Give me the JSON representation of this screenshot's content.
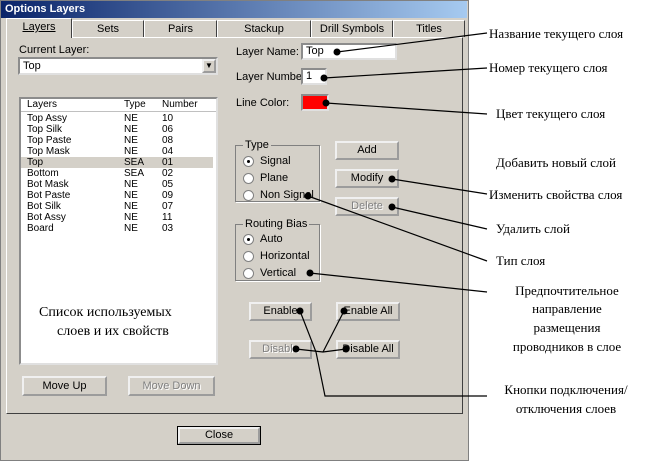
{
  "window": {
    "title": "Options Layers"
  },
  "tabs": [
    "Layers",
    "Sets",
    "Pairs",
    "Stackup",
    "Drill Symbols",
    "Titles"
  ],
  "current_layer": {
    "label": "Current Layer:",
    "value": "Top"
  },
  "list": {
    "headers": [
      "Layers",
      "Type",
      "Number"
    ],
    "rows": [
      [
        "Top Assy",
        "NE",
        "10"
      ],
      [
        "Top Silk",
        "NE",
        "06"
      ],
      [
        "Top Paste",
        "NE",
        "08"
      ],
      [
        "Top Mask",
        "NE",
        "04"
      ],
      [
        "Top",
        "SEA",
        "01"
      ],
      [
        "Bottom",
        "SEA",
        "02"
      ],
      [
        "Bot Mask",
        "NE",
        "05"
      ],
      [
        "Bot Paste",
        "NE",
        "09"
      ],
      [
        "Bot Silk",
        "NE",
        "07"
      ],
      [
        "Bot Assy",
        "NE",
        "11"
      ],
      [
        "Board",
        "NE",
        "03"
      ]
    ],
    "selected_row": 4
  },
  "fields": {
    "layer_name_label": "Layer Name:",
    "layer_name": "Top",
    "layer_number_label": "Layer Number:",
    "layer_number": "1",
    "line_color_label": "Line Color:"
  },
  "colors": {
    "line_color": "#ff0000"
  },
  "type_group": {
    "title": "Type",
    "options": [
      "Signal",
      "Plane",
      "Non Signal"
    ],
    "selected": 0
  },
  "routing_group": {
    "title": "Routing Bias",
    "options": [
      "Auto",
      "Horizontal",
      "Vertical"
    ],
    "selected": 0
  },
  "buttons": {
    "add": "Add",
    "modify": "Modify",
    "delete": "Delete",
    "enable": "Enable",
    "enable_all": "Enable All",
    "disable": "Disable",
    "disable_all": "Disable All",
    "move_up": "Move Up",
    "move_down": "Move Down",
    "close": "Close"
  },
  "annotations": {
    "list_caption_1": "Список используемых",
    "list_caption_2": "слоев и их свойств",
    "layer_name": "Название текущего слоя",
    "layer_number": "Номер текущего слоя",
    "line_color": "Цвет текущего слоя",
    "add": "Добавить новый слой",
    "modify": "Изменить свойства слоя",
    "delete": "Удалить слой",
    "type": "Тип слоя",
    "routing_1": "Предпочтительное",
    "routing_2": "направление",
    "routing_3": "размещения",
    "routing_4": "проводников в слое",
    "enable_1": "Кнопки подключения/",
    "enable_2": "отключения слоев"
  }
}
